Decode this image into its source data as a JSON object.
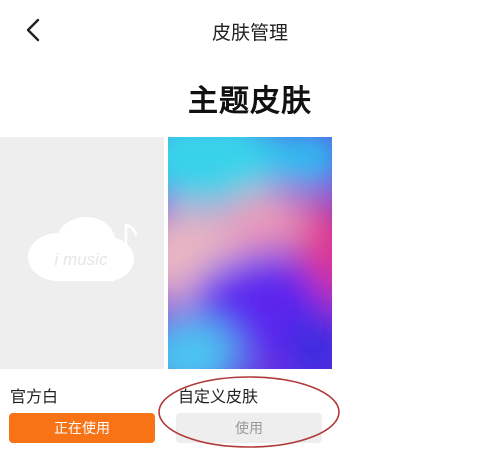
{
  "header": {
    "title": "皮肤管理"
  },
  "section": {
    "title": "主题皮肤"
  },
  "skins": [
    {
      "name": "官方白",
      "button_label": "正在使用"
    },
    {
      "name": "自定义皮肤",
      "button_label": "使用"
    }
  ],
  "logo_text": "i music",
  "colors": {
    "accent": "#f77316",
    "disabled_bg": "#eeeeee",
    "annotation": "#b03a3a"
  }
}
